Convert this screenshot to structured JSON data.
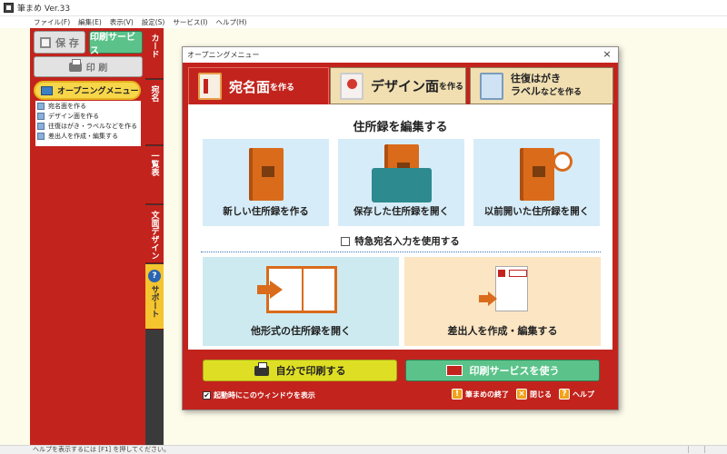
{
  "window": {
    "title": "筆まめ Ver.33"
  },
  "menubar": [
    "ファイル(F)",
    "編集(E)",
    "表示(V)",
    "設定(S)",
    "サービス(I)",
    "ヘルプ(H)"
  ],
  "left_panel": {
    "save_label": "保 存",
    "service_label": "印刷サービス",
    "print_label": "印 刷",
    "opening_menu_label": "オープニングメニュー",
    "submenu": [
      "宛名面を作る",
      "デザイン面を作る",
      "往復はがき・ラベルなどを作る",
      "差出人を作成・編集する"
    ]
  },
  "vertical_tabs": [
    "カード",
    "宛名",
    "一覧表",
    "文面デザイン",
    "サポート"
  ],
  "dialog": {
    "title": "オープニングメニュー",
    "close_glyph": "×",
    "tabs": [
      {
        "big": "宛名面",
        "small": "を作る"
      },
      {
        "big": "デザイン面",
        "small": "を作る"
      },
      {
        "line1": "往復はがき",
        "line2_big": "ラベル",
        "line2_small": "などを作る"
      }
    ],
    "heading": "住所録を編集する",
    "cards": [
      "新しい住所録を作る",
      "保存した住所録を開く",
      "以前開いた住所録を開く"
    ],
    "urgent_checkbox_label": "特急宛名入力を使用する",
    "big_cards": [
      "他形式の住所録を開く",
      "差出人を作成・編集する"
    ],
    "self_print_label": "自分で印刷する",
    "use_service_label": "印刷サービスを使う",
    "startup_checkbox_label": "起動時にこのウィンドウを表示",
    "startup_checked_glyph": "✔",
    "quit_label": "筆まめの終了",
    "close_label": "閉じる",
    "help_label": "ヘルプ"
  },
  "statusbar": {
    "text": "ヘルプを表示するには [F1] を押してください。"
  }
}
